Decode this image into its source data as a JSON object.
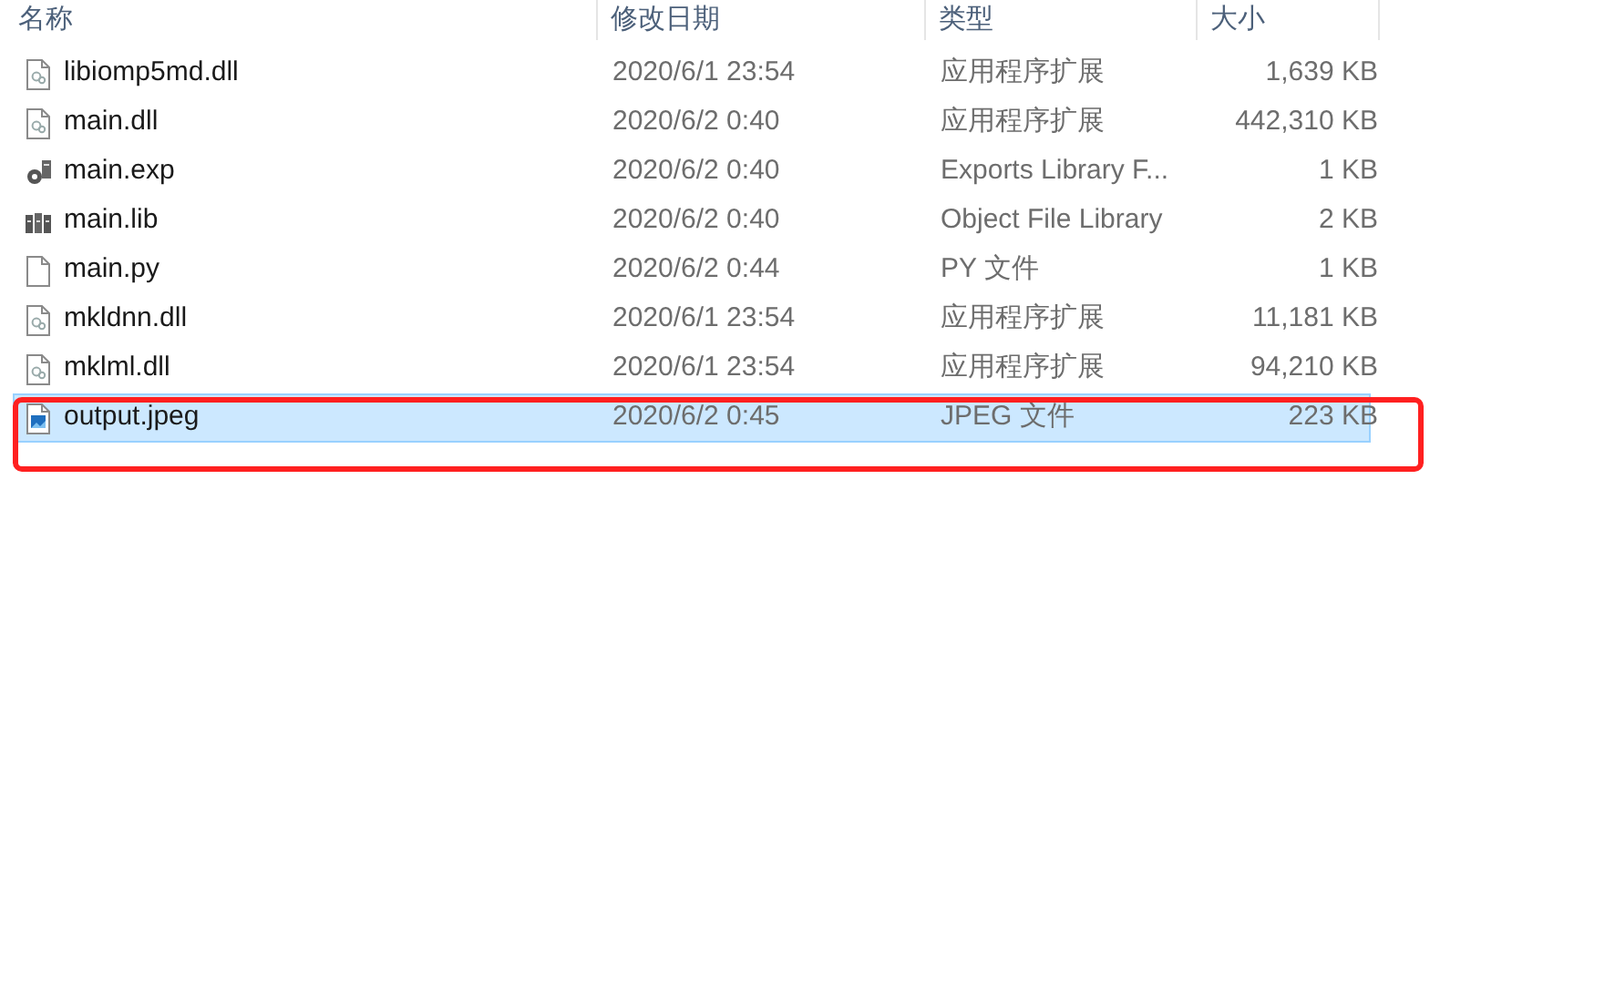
{
  "columns": [
    "名称",
    "修改日期",
    "类型",
    "大小"
  ],
  "rows": [
    {
      "kind": "dll",
      "name": "libiomp5md.dll",
      "modified": "2020/6/1 23:54",
      "type": "应用程序扩展",
      "size": "1,639 KB",
      "selected": false,
      "marked": false
    },
    {
      "kind": "dll",
      "name": "main.dll",
      "modified": "2020/6/2 0:40",
      "type": "应用程序扩展",
      "size": "442,310 KB",
      "selected": false,
      "marked": false
    },
    {
      "kind": "exp",
      "name": "main.exp",
      "modified": "2020/6/2 0:40",
      "type": "Exports Library F...",
      "size": "1 KB",
      "selected": false,
      "marked": false
    },
    {
      "kind": "lib",
      "name": "main.lib",
      "modified": "2020/6/2 0:40",
      "type": "Object File Library",
      "size": "2 KB",
      "selected": false,
      "marked": false
    },
    {
      "kind": "file",
      "name": "main.py",
      "modified": "2020/6/2 0:44",
      "type": "PY 文件",
      "size": "1 KB",
      "selected": false,
      "marked": false
    },
    {
      "kind": "dll",
      "name": "mkldnn.dll",
      "modified": "2020/6/1 23:54",
      "type": "应用程序扩展",
      "size": "11,181 KB",
      "selected": false,
      "marked": false
    },
    {
      "kind": "dll",
      "name": "mklml.dll",
      "modified": "2020/6/1 23:54",
      "type": "应用程序扩展",
      "size": "94,210 KB",
      "selected": false,
      "marked": false
    },
    {
      "kind": "image",
      "name": "output.jpeg",
      "modified": "2020/6/2 0:45",
      "type": "JPEG 文件",
      "size": "223 KB",
      "selected": true,
      "marked": true
    }
  ]
}
